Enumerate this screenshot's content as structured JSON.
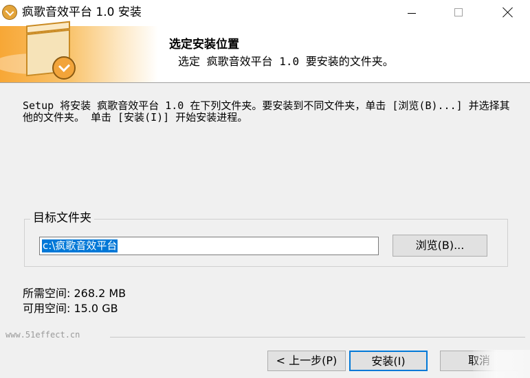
{
  "window": {
    "title": "疯歌音效平台 1.0 安装",
    "icon": "installer-app-icon",
    "controls": {
      "minimize": "minimize-icon",
      "maximize": "maximize-icon",
      "close": "close-icon"
    }
  },
  "header": {
    "title": "选定安装位置",
    "subtitle": "选定 疯歌音效平台 1.0 要安装的文件夹。",
    "banner_icon": "install-box-icon"
  },
  "body": {
    "description": "Setup 将安装 疯歌音效平台 1.0 在下列文件夹。要安装到不同文件夹，单击 [浏览(B)...] 并选择其他的文件夹。 单击 [安装(I)] 开始安装进程。",
    "destination": {
      "group_label": "目标文件夹",
      "path_value": "c:\\疯歌音效平台",
      "browse_label": "浏览(B)..."
    },
    "space_required": "所需空间: 268.2 MB",
    "space_available": "可用空间: 15.0 GB"
  },
  "footer": {
    "branding": "www.51effect.cn",
    "back_label": "< 上一步(P)",
    "install_label": "安装(I)",
    "cancel_label": "取消"
  },
  "colors": {
    "accent": "#0078d7",
    "banner_orange": "#f7a736",
    "background": "#f0f0f0"
  }
}
